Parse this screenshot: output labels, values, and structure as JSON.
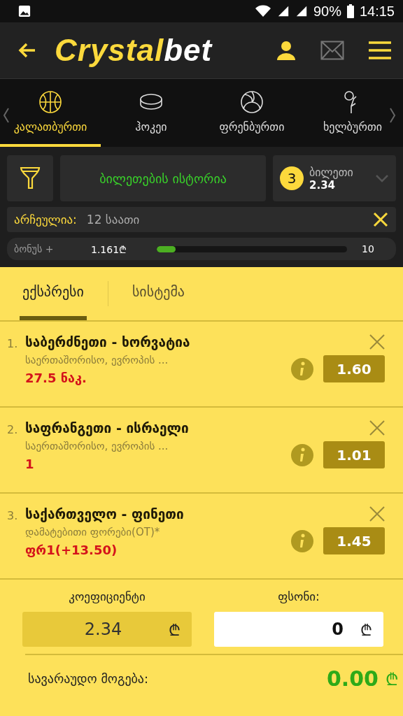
{
  "status_bar": {
    "battery": "90%",
    "time": "14:15"
  },
  "header": {
    "logo_main": "Crystal",
    "logo_accent": "bet"
  },
  "sports": [
    {
      "label": "კალათბურთი",
      "kind": "basketball",
      "selected": true
    },
    {
      "label": "ჰოკეი",
      "kind": "hockey",
      "selected": false
    },
    {
      "label": "ფრენბურთი",
      "kind": "volleyball",
      "selected": false
    },
    {
      "label": "ხელბურთი",
      "kind": "handball",
      "selected": false
    }
  ],
  "history_button": "ბილეთების ისტორია",
  "ticket": {
    "count": "3",
    "label": "ბილეთი",
    "odds": "2.34"
  },
  "filter": {
    "label": "არჩეულია:",
    "value": "12 საათი"
  },
  "bonus": {
    "label": "ბონუს +",
    "amount": "1.161₾",
    "level": 0.1,
    "target": "10"
  },
  "bet_tabs": [
    {
      "label": "ექსპრესი",
      "selected": true
    },
    {
      "label": "სისტემა",
      "selected": false
    }
  ],
  "bets": [
    {
      "index": "1.",
      "match": "საბერძნეთი - ხორვატია",
      "league": "საერთაშორისო, ევროპის ...",
      "pick": "27.5 ნაკ.",
      "odds": "1.60"
    },
    {
      "index": "2.",
      "match": "საფრანგეთი - ისრაელი",
      "league": "საერთაშორისო, ევროპის ...",
      "pick": "1",
      "odds": "1.01"
    },
    {
      "index": "3.",
      "match": "საქართველო - ფინეთი",
      "league": "დამატებითი ფორები(OT)*",
      "pick": "ფრ1(+13.50)",
      "odds": "1.45"
    }
  ],
  "summary": {
    "coef_label": "კოეფიციენტი",
    "coef_value": "2.34",
    "currency": "₾",
    "stake_label": "ფსონი:",
    "stake_value": "0",
    "stake_currency": "₾",
    "win_label": "სავარაუდო მოგება:",
    "win_value": "0.00",
    "win_currency": "₾"
  }
}
